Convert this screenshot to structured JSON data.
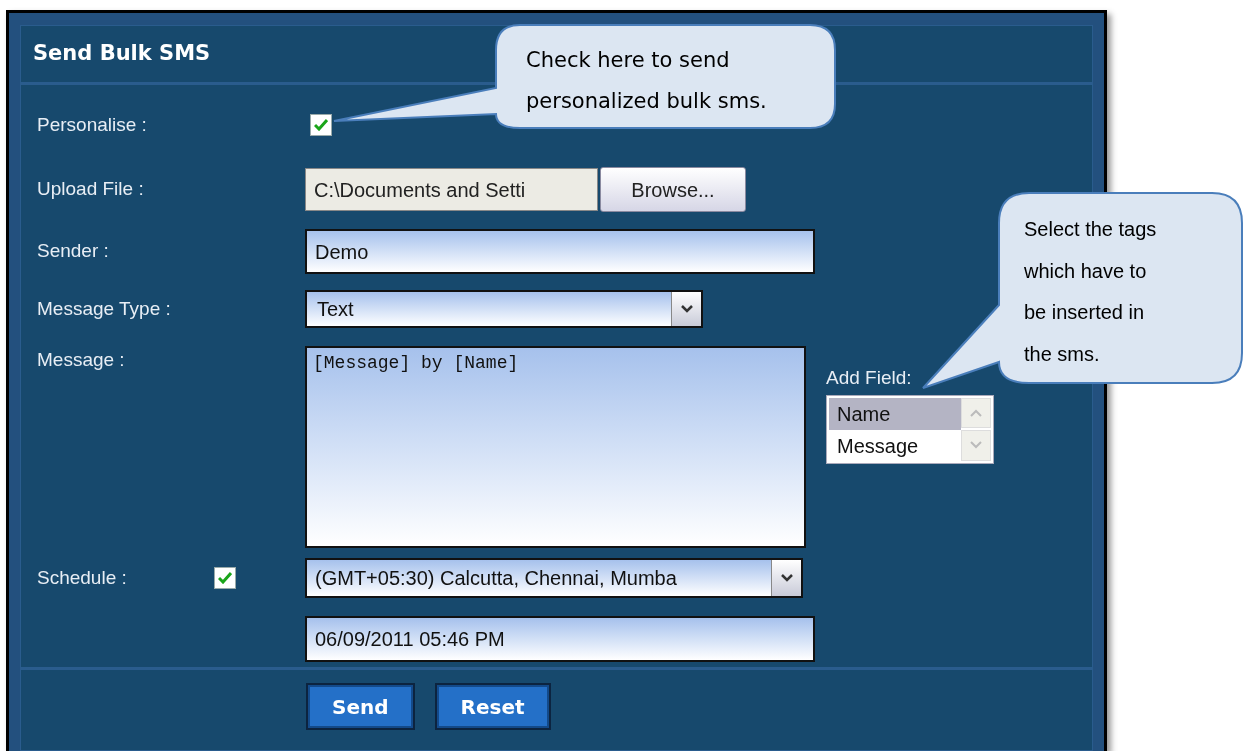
{
  "panel": {
    "title": "Send Bulk SMS"
  },
  "fields": [
    {
      "kind": "checkbox",
      "label": "Personalise :",
      "checked": true
    },
    {
      "kind": "file",
      "label": "Upload File :",
      "value": "C:\\Documents and Setti",
      "button": "Browse..."
    },
    {
      "kind": "text",
      "label": "Sender :",
      "value": "Demo"
    },
    {
      "kind": "select",
      "label": "Message Type :",
      "value": "Text"
    },
    {
      "kind": "textarea",
      "label": "Message :",
      "value": "[Message] by [Name]",
      "add_field": {
        "label": "Add Field:",
        "options": [
          {
            "label": "Name",
            "selected": true
          },
          {
            "label": "Message",
            "selected": false
          }
        ]
      }
    },
    {
      "kind": "schedule",
      "label": "Schedule :",
      "checked": true,
      "timezone": "(GMT+05:30) Calcutta, Chennai, Mumba",
      "datetime": "06/09/2011 05:46 PM"
    }
  ],
  "buttons": [
    "Send",
    "Reset"
  ],
  "callouts": [
    {
      "lines": [
        "Check here to send",
        "personalized bulk sms."
      ]
    },
    {
      "lines": [
        "Select the tags",
        "which have to",
        "be inserted in",
        "the sms."
      ]
    }
  ]
}
